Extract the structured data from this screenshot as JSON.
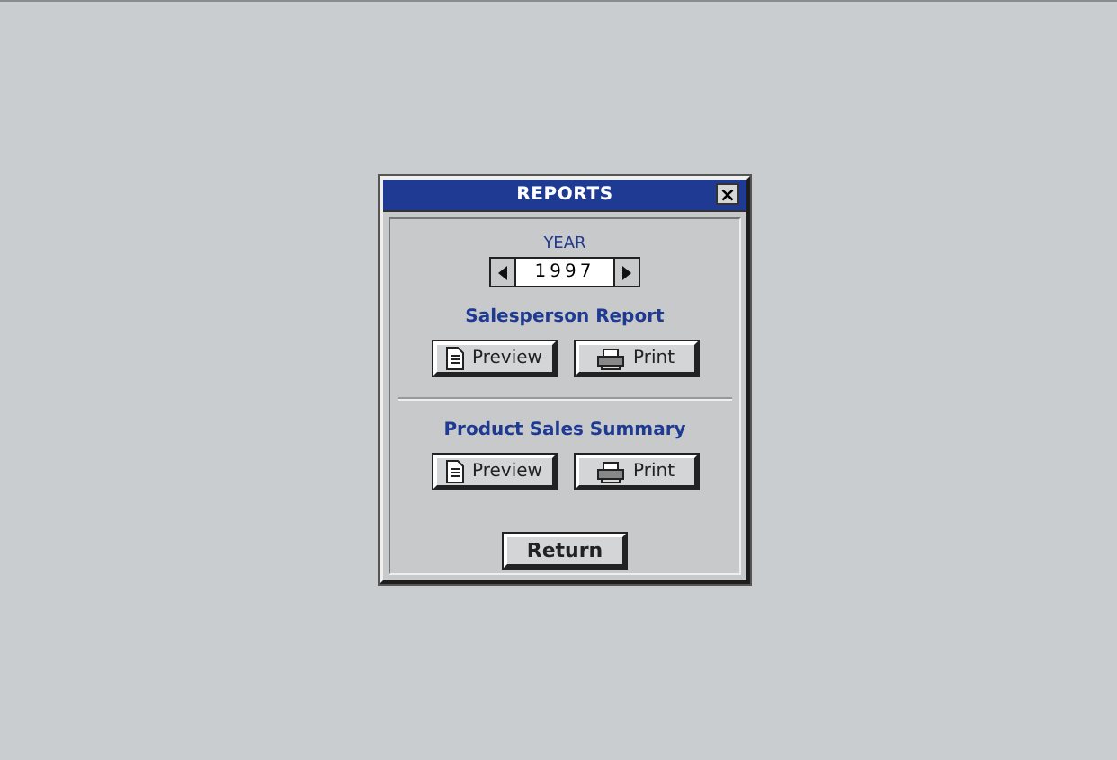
{
  "window": {
    "title": "REPORTS",
    "close": "×"
  },
  "year": {
    "label": "YEAR",
    "value": "1997"
  },
  "sections": [
    {
      "title": "Salesperson Report",
      "buttons": [
        {
          "label": "Preview",
          "kind": "preview"
        },
        {
          "label": "Print",
          "kind": "print"
        }
      ]
    },
    {
      "title": "Product Sales Summary",
      "buttons": [
        {
          "label": "Preview",
          "kind": "preview"
        },
        {
          "label": "Print",
          "kind": "print"
        }
      ]
    }
  ],
  "return_button": "Return"
}
